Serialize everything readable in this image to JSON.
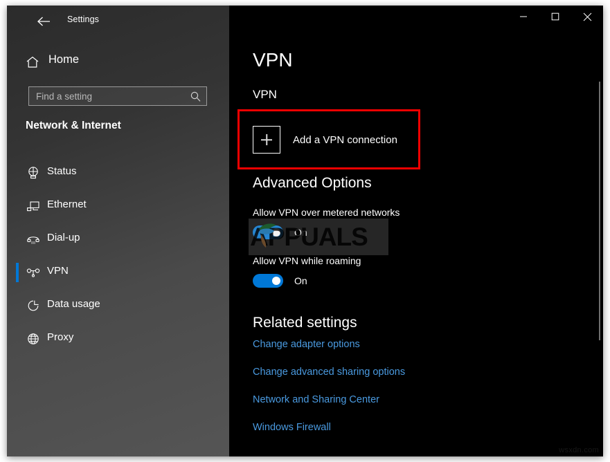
{
  "window": {
    "title": "Settings",
    "back_icon": "back-arrow-icon",
    "controls": {
      "minimize": "minimize-icon",
      "maximize": "maximize-icon",
      "close": "close-icon"
    }
  },
  "sidebar": {
    "home_label": "Home",
    "home_icon": "home-icon",
    "search": {
      "placeholder": "Find a setting",
      "value": "",
      "icon": "search-icon"
    },
    "category_heading": "Network & Internet",
    "items": [
      {
        "label": "Status",
        "icon": "network-status-icon",
        "selected": false
      },
      {
        "label": "Ethernet",
        "icon": "ethernet-icon",
        "selected": false
      },
      {
        "label": "Dial-up",
        "icon": "dialup-phone-icon",
        "selected": false
      },
      {
        "label": "VPN",
        "icon": "vpn-icon",
        "selected": true
      },
      {
        "label": "Data usage",
        "icon": "pie-chart-icon",
        "selected": false
      },
      {
        "label": "Proxy",
        "icon": "globe-icon",
        "selected": false
      }
    ]
  },
  "main": {
    "page_title": "VPN",
    "vpn_section": {
      "heading": "VPN",
      "add_connection_label": "Add a VPN connection",
      "add_connection_icon": "plus-icon"
    },
    "advanced_options": {
      "heading": "Advanced Options",
      "settings": [
        {
          "label": "Allow VPN over metered networks",
          "state": "On",
          "on": true
        },
        {
          "label": "Allow VPN while roaming",
          "state": "On",
          "on": true
        }
      ]
    },
    "related_settings": {
      "heading": "Related settings",
      "links": [
        "Change adapter options",
        "Change advanced sharing options",
        "Network and Sharing Center",
        "Windows Firewall"
      ]
    }
  },
  "watermark": {
    "brand_text": "APPUALS",
    "site_text": "wsxdn.com"
  },
  "colors": {
    "accent": "#0078d7",
    "link": "#4a9ae0",
    "annotation": "#f20000",
    "content_bg": "#000000"
  }
}
